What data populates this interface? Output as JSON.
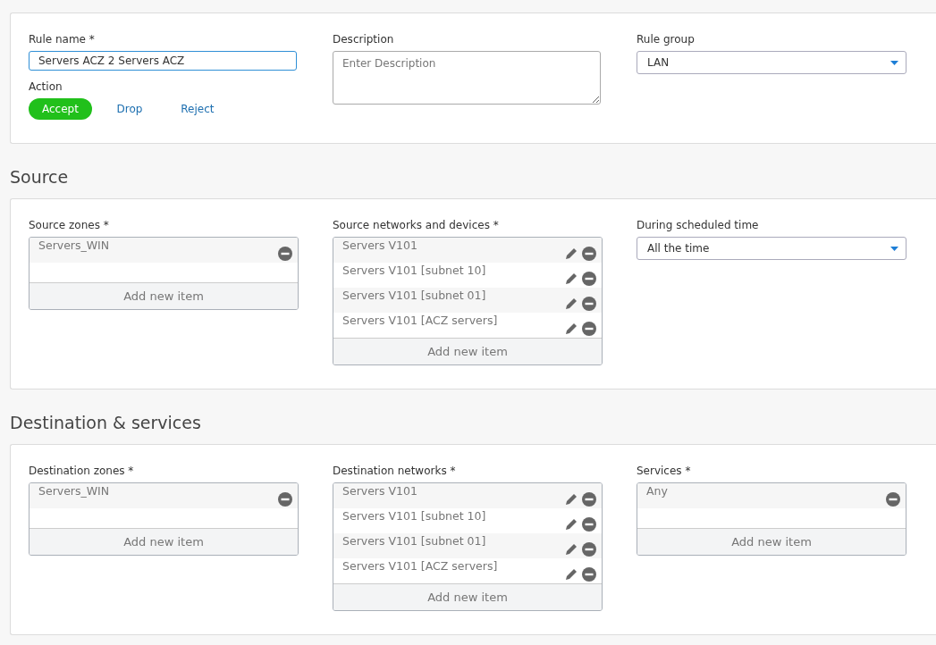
{
  "rule": {
    "name_label": "Rule name *",
    "name_value": "Servers ACZ 2 Servers ACZ",
    "action_label": "Action",
    "actions": [
      {
        "label": "Accept",
        "selected": true
      },
      {
        "label": "Drop",
        "selected": false
      },
      {
        "label": "Reject",
        "selected": false
      }
    ],
    "description_label": "Description",
    "description_placeholder": "Enter Description",
    "group_label": "Rule group",
    "group_value": "LAN"
  },
  "sections": [
    {
      "title": "Source",
      "fields": [
        {
          "kind": "list",
          "label": "Source zones *",
          "add_label": "Add new item",
          "items": [
            {
              "text": "Servers_WIN",
              "editable": false
            }
          ]
        },
        {
          "kind": "list",
          "label": "Source networks and devices *",
          "add_label": "Add new item",
          "items": [
            {
              "text": "Servers V101",
              "editable": true
            },
            {
              "text": "Servers V101 [subnet 10]",
              "editable": true
            },
            {
              "text": "Servers V101 [subnet 01]",
              "editable": true
            },
            {
              "text": "Servers V101 [ACZ servers]",
              "editable": true
            }
          ]
        },
        {
          "kind": "select",
          "label": "During scheduled time",
          "value": "All the time"
        }
      ]
    },
    {
      "title": "Destination & services",
      "fields": [
        {
          "kind": "list",
          "label": "Destination zones *",
          "add_label": "Add new item",
          "items": [
            {
              "text": "Servers_WIN",
              "editable": false
            }
          ]
        },
        {
          "kind": "list",
          "label": "Destination networks *",
          "add_label": "Add new item",
          "items": [
            {
              "text": "Servers V101",
              "editable": true
            },
            {
              "text": "Servers V101 [subnet 10]",
              "editable": true
            },
            {
              "text": "Servers V101 [subnet 01]",
              "editable": true
            },
            {
              "text": "Servers V101 [ACZ servers]",
              "editable": true
            }
          ]
        },
        {
          "kind": "list",
          "label": "Services *",
          "add_label": "Add new item",
          "items": [
            {
              "text": "Any",
              "editable": false
            }
          ]
        }
      ]
    }
  ]
}
